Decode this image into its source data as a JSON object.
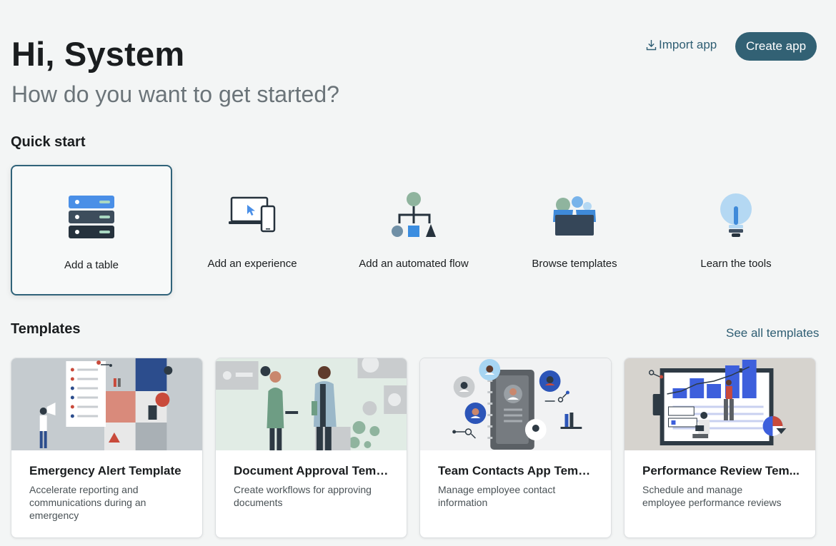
{
  "header": {
    "greeting": "Hi, System",
    "subtitle": "How do you want to get started?",
    "import_label": "Import app",
    "create_label": "Create app"
  },
  "quick_start": {
    "title": "Quick start",
    "items": [
      {
        "label": "Add a table",
        "icon": "table-icon"
      },
      {
        "label": "Add an experience",
        "icon": "devices-icon"
      },
      {
        "label": "Add an automated flow",
        "icon": "flow-icon"
      },
      {
        "label": "Browse templates",
        "icon": "templates-box-icon"
      },
      {
        "label": "Learn the tools",
        "icon": "lightbulb-icon"
      }
    ]
  },
  "templates": {
    "title": "Templates",
    "see_all_label": "See all templates",
    "items": [
      {
        "name": "Emergency Alert Template",
        "description": "Accelerate reporting and communications during an emergency"
      },
      {
        "name": "Document Approval Temp...",
        "description": "Create workflows for approving documents"
      },
      {
        "name": "Team Contacts App Templ...",
        "description": "Manage employee contact information"
      },
      {
        "name": "Performance Review Tem...",
        "description": "Schedule and manage employee performance reviews"
      }
    ]
  },
  "colors": {
    "primary": "#326174",
    "link": "#2f5e73",
    "background": "#f3f5f5"
  }
}
